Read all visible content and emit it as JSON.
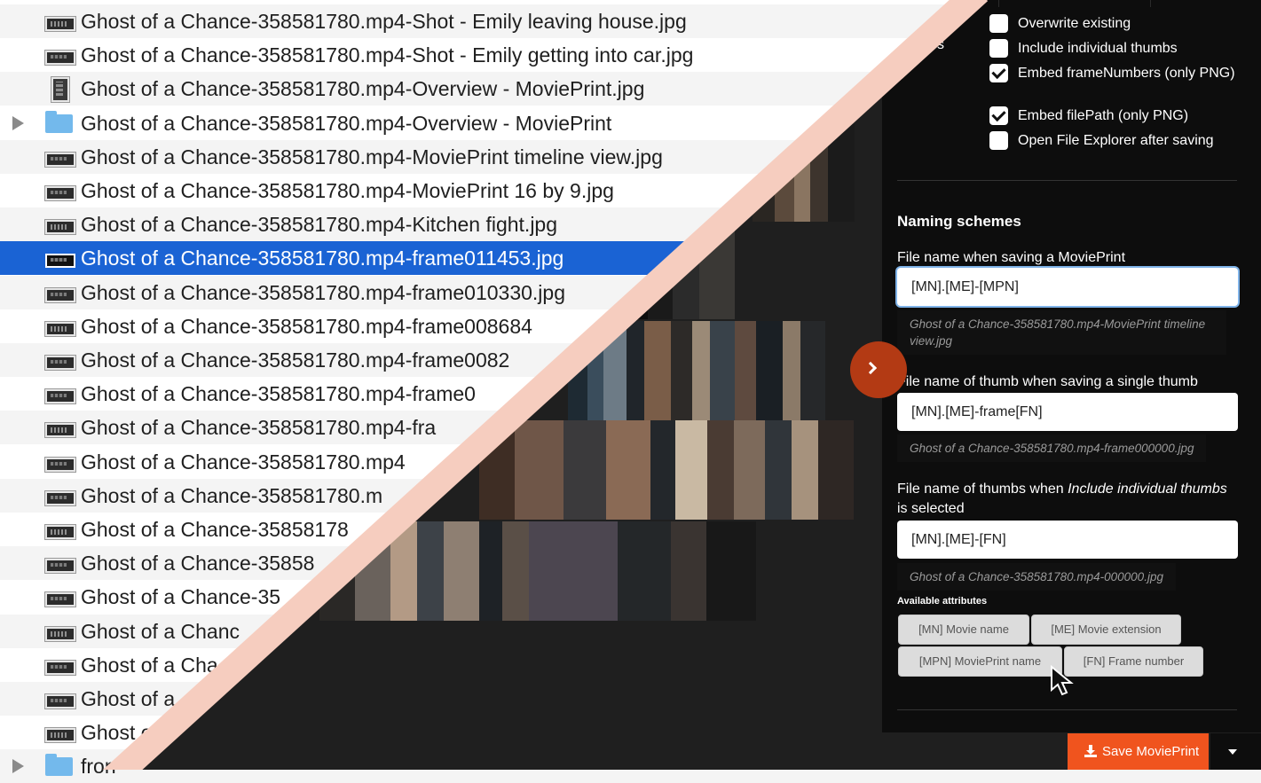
{
  "file_list": {
    "rows": [
      {
        "name": "Ghost of a Chance-358581780.mp4-Shot - Emily leaving house.jpg",
        "kind": "image"
      },
      {
        "name": "Ghost of a Chance-358581780.mp4-Shot - Emily getting into car.jpg",
        "kind": "image"
      },
      {
        "name": "Ghost of a Chance-358581780.mp4-Overview - MoviePrint.jpg",
        "kind": "document"
      },
      {
        "name": "Ghost of a Chance-358581780.mp4-Overview - MoviePrint",
        "kind": "folder"
      },
      {
        "name": "Ghost of a Chance-358581780.mp4-MoviePrint timeline view.jpg",
        "kind": "image"
      },
      {
        "name": "Ghost of a Chance-358581780.mp4-MoviePrint 16 by 9.jpg",
        "kind": "image"
      },
      {
        "name": "Ghost of a Chance-358581780.mp4-Kitchen fight.jpg",
        "kind": "image"
      },
      {
        "name": "Ghost of a Chance-358581780.mp4-frame011453.jpg",
        "kind": "image",
        "selected": true
      },
      {
        "name": "Ghost of a Chance-358581780.mp4-frame010330.jpg",
        "kind": "image"
      },
      {
        "name": "Ghost of a Chance-358581780.mp4-frame008684",
        "kind": "image"
      },
      {
        "name": "Ghost of a Chance-358581780.mp4-frame0082",
        "kind": "image"
      },
      {
        "name": "Ghost of a Chance-358581780.mp4-frame0",
        "kind": "image"
      },
      {
        "name": "Ghost of a Chance-358581780.mp4-fra",
        "kind": "image"
      },
      {
        "name": "Ghost of a Chance-358581780.mp4",
        "kind": "image"
      },
      {
        "name": "Ghost of a Chance-358581780.m",
        "kind": "image"
      },
      {
        "name": "Ghost of a Chance-35858178",
        "kind": "image"
      },
      {
        "name": "Ghost of a Chance-35858",
        "kind": "image"
      },
      {
        "name": "Ghost of a Chance-35",
        "kind": "image"
      },
      {
        "name": "Ghost of a Chanc",
        "kind": "image"
      },
      {
        "name": "Ghost of a Cha",
        "kind": "image"
      },
      {
        "name": "Ghost of a",
        "kind": "image"
      },
      {
        "name": "Ghost o",
        "kind": "image"
      },
      {
        "name": "fron",
        "kind": "folder"
      }
    ]
  },
  "settings": {
    "left_fragment": "s",
    "checkboxes": [
      {
        "label": "Overwrite existing",
        "checked": false
      },
      {
        "label": "Include individual thumbs",
        "checked": false
      },
      {
        "label": "Embed frameNumbers (only PNG)",
        "checked": true
      },
      {
        "label": "Embed filePath (only PNG)",
        "checked": true
      },
      {
        "label": "Open File Explorer after saving",
        "checked": false
      }
    ],
    "naming_title": "Naming schemes",
    "movieprint_label": "File name when saving a MoviePrint",
    "movieprint_value": "[MN].[ME]-[MPN]",
    "movieprint_preview": "Ghost of a Chance-358581780.mp4-MoviePrint timeline view.jpg",
    "single_thumb_label": "File name of thumb when saving a single thumb",
    "single_thumb_value": "[MN].[ME]-frame[FN]",
    "single_thumb_preview": "Ghost of a Chance-358581780.mp4-frame000000.jpg",
    "thumbs_label_before": "File name of thumbs when ",
    "thumbs_label_em": "Include individual thumbs",
    "thumbs_label_after": " is selected",
    "thumbs_value": "[MN].[ME]-[FN]",
    "thumbs_preview": "Ghost of a Chance-358581780.mp4-000000.jpg",
    "attributes_title": "Available attributes",
    "attributes": [
      "[MN] Movie name",
      "[ME] Movie extension",
      "[MPN] MoviePrint name",
      "[FN] Frame number"
    ]
  },
  "footer": {
    "save_label": "Save MoviePrint"
  },
  "colors": {
    "selection": "#1a63d4",
    "save_button": "#f0541e",
    "collapse_button": "#b33a14",
    "divider": "#f6cdbf"
  }
}
